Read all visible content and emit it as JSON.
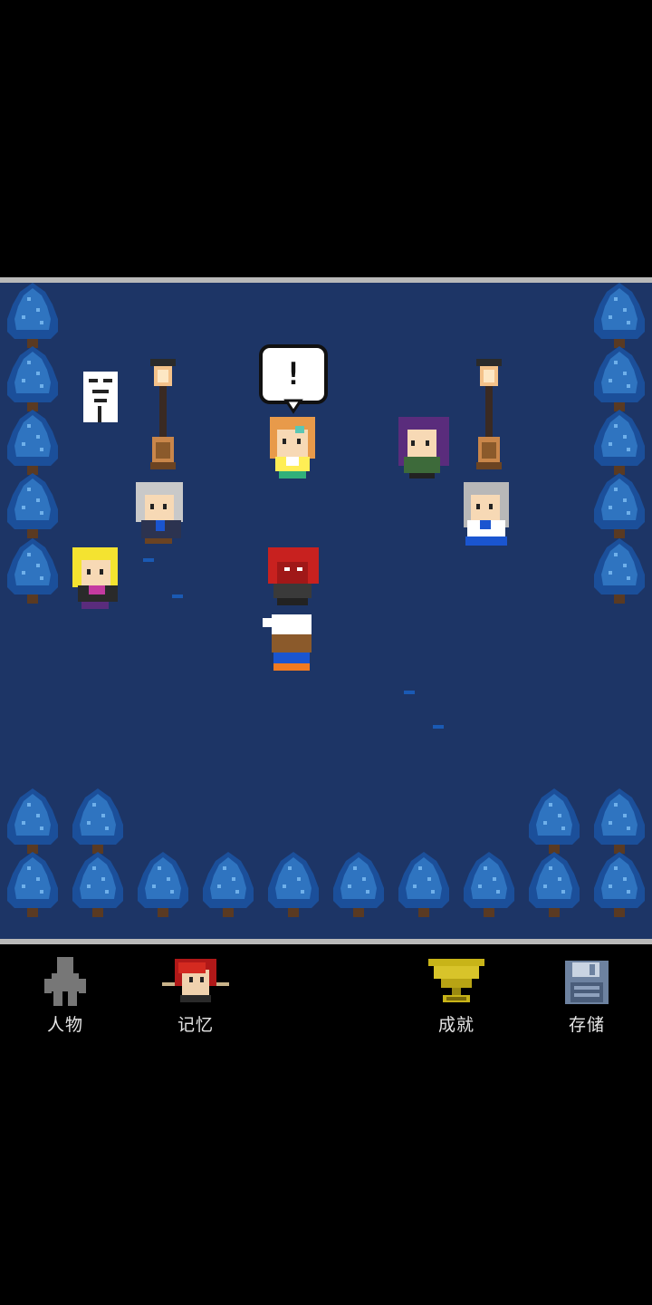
{
  "scene": {
    "speech_bubble": "!",
    "colors": {
      "ground": "#1d3566",
      "tree_dark": "#1b4f9a",
      "tree_light": "#3a86d0",
      "frame": "#b9b9b9"
    }
  },
  "menu": {
    "characters": {
      "label": "人物",
      "icon": "person-silhouette-icon"
    },
    "memories": {
      "label": "记忆",
      "icon": "red-hair-portrait-icon"
    },
    "achievements": {
      "label": "成就",
      "icon": "trophy-icon"
    },
    "save": {
      "label": "存储",
      "icon": "floppy-disk-icon"
    }
  }
}
